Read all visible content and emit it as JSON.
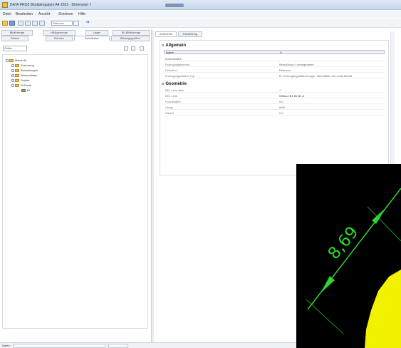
{
  "window": {
    "title": "DATA PRO3 Biodatengaben A4 2021 - Dimension 7"
  },
  "menu": [
    "Datei",
    "Bearbeiten",
    "Ansicht",
    "Zeichnen",
    "Hilfe"
  ],
  "toolbar": {
    "field_value": "Referenz"
  },
  "left_tabs_row1": [
    "Bildlinienge",
    "HBAgebunde",
    "Lager",
    "BL Bildlinienge"
  ],
  "left_tabs_row2": [
    "Datum",
    "Schulen",
    "Schuldaten",
    "Bildungsgrößen"
  ],
  "tree": {
    "filter_label": "Zeilen",
    "items": [
      {
        "label": "Meine All",
        "toggle": "-",
        "depth": 0
      },
      {
        "label": "Zeichnung",
        "toggle": "+",
        "depth": 1
      },
      {
        "label": "Bemaßungen",
        "toggle": "+",
        "depth": 1
      },
      {
        "label": "Skizzenlinien",
        "toggle": "+",
        "depth": 1
      },
      {
        "label": "Punkte",
        "toggle": "+",
        "depth": 1
      },
      {
        "label": "Gl.Positi",
        "toggle": "-",
        "depth": 1
      },
      {
        "label": "BL",
        "toggle": "",
        "depth": 2
      }
    ]
  },
  "right_tabs": [
    "Geometrie",
    "Darstellung"
  ],
  "properties": {
    "general_title": "Allgemein",
    "rows1": [
      {
        "key": "Name",
        "value": "B",
        "selected": true
      },
      {
        "key": "Kommentare",
        "value": "",
        "category": true
      },
      {
        "key": "Erzeugungstechnik",
        "value": "Bemaßung / Lineargeraden"
      },
      {
        "key": "Definition",
        "value": "Referenz"
      },
      {
        "key": "Erzeugungsattribut Typ",
        "value": "B - Erzeugungsattribut Lage - Bemaßline an Lineal Abbild"
      }
    ],
    "geometry_title": "Geometrie",
    "rows2": [
      {
        "key": "BEL Linie aktiv",
        "value": "✓"
      },
      {
        "key": "BEL Linie",
        "value": "Without B1 B1 B1 A"
      },
      {
        "key": "Koordinaten",
        "value": "0,0"
      },
      {
        "key": "Länge",
        "value": "8,69"
      },
      {
        "key": "Winkel",
        "value": "0,0"
      }
    ]
  },
  "status": {
    "label": "Daten"
  },
  "cad": {
    "dimension_text": "8,69",
    "colors": {
      "background": "#000000",
      "dimension": "#2fd62f",
      "shape": "#f2f200"
    }
  }
}
